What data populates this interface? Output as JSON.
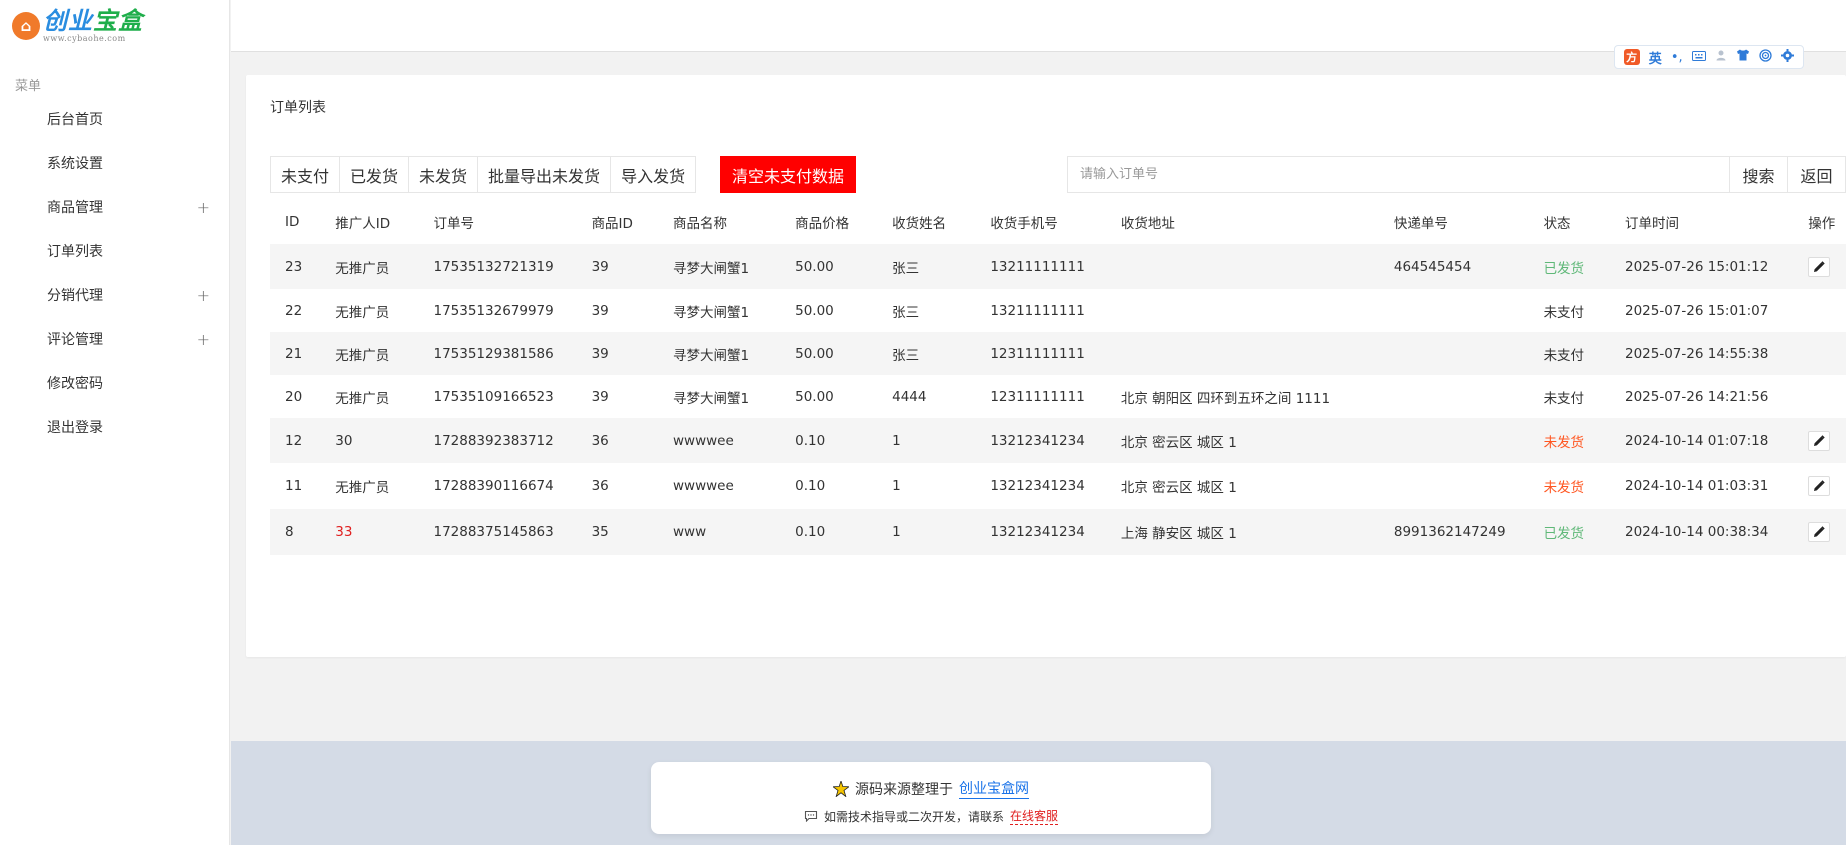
{
  "sidebar": {
    "logo_text_1": "创业",
    "logo_text_2": "宝盒",
    "logo_url": "www.cybaohe.com",
    "caption": "菜单",
    "items": [
      {
        "label": "后台首页",
        "expand": ""
      },
      {
        "label": "系统设置",
        "expand": ""
      },
      {
        "label": "商品管理",
        "expand": "+"
      },
      {
        "label": "订单列表",
        "expand": ""
      },
      {
        "label": "分销代理",
        "expand": "+"
      },
      {
        "label": "评论管理",
        "expand": "+"
      },
      {
        "label": "修改密码",
        "expand": ""
      },
      {
        "label": "退出登录",
        "expand": ""
      }
    ]
  },
  "ime": {
    "logo": "方",
    "lang": "英",
    "punct": "•,"
  },
  "card": {
    "title": "订单列表"
  },
  "filters": {
    "buttons": [
      "未支付",
      "已发货",
      "未发货",
      "批量导出未发货",
      "导入发货"
    ],
    "danger": "清空未支付数据"
  },
  "search": {
    "placeholder": "请输入订单号",
    "search_label": "搜索",
    "back_label": "返回"
  },
  "table": {
    "headers": [
      "ID",
      "推广人ID",
      "订单号",
      "商品ID",
      "商品名称",
      "商品价格",
      "收货姓名",
      "收货手机号",
      "收货地址",
      "快递单号",
      "状态",
      "订单时间",
      "操作"
    ],
    "rows": [
      {
        "id": "23",
        "promoter": "无推广员",
        "order_no": "17535132721319",
        "product_id": "39",
        "product_name": "寻梦大闸蟹1",
        "price": "50.00",
        "name": "张三",
        "phone": "13211111111",
        "address": "",
        "tracking": "464545454",
        "status": "已发货",
        "time": "2025-07-26 15:01:12",
        "editable": true
      },
      {
        "id": "22",
        "promoter": "无推广员",
        "order_no": "17535132679979",
        "product_id": "39",
        "product_name": "寻梦大闸蟹1",
        "price": "50.00",
        "name": "张三",
        "phone": "13211111111",
        "address": "",
        "tracking": "",
        "status": "未支付",
        "time": "2025-07-26 15:01:07",
        "editable": false
      },
      {
        "id": "21",
        "promoter": "无推广员",
        "order_no": "17535129381586",
        "product_id": "39",
        "product_name": "寻梦大闸蟹1",
        "price": "50.00",
        "name": "张三",
        "phone": "12311111111",
        "address": "",
        "tracking": "",
        "status": "未支付",
        "time": "2025-07-26 14:55:38",
        "editable": false
      },
      {
        "id": "20",
        "promoter": "无推广员",
        "order_no": "17535109166523",
        "product_id": "39",
        "product_name": "寻梦大闸蟹1",
        "price": "50.00",
        "name": "4444",
        "phone": "12311111111",
        "address": "北京 朝阳区 四环到五环之间 1111",
        "tracking": "",
        "status": "未支付",
        "time": "2025-07-26 14:21:56",
        "editable": false
      },
      {
        "id": "12",
        "promoter": "30",
        "order_no": "17288392383712",
        "product_id": "36",
        "product_name": "wwwwee",
        "price": "0.10",
        "name": "1",
        "phone": "13212341234",
        "address": "北京 密云区 城区 1",
        "tracking": "",
        "status": "未发货",
        "time": "2024-10-14 01:07:18",
        "editable": true
      },
      {
        "id": "11",
        "promoter": "无推广员",
        "order_no": "17288390116674",
        "product_id": "36",
        "product_name": "wwwwee",
        "price": "0.10",
        "name": "1",
        "phone": "13212341234",
        "address": "北京 密云区 城区 1",
        "tracking": "",
        "status": "未发货",
        "time": "2024-10-14 01:03:31",
        "editable": true
      },
      {
        "id": "8",
        "promoter": "33",
        "order_no": "17288375145863",
        "product_id": "35",
        "product_name": "www",
        "price": "0.10",
        "name": "1",
        "phone": "13212341234",
        "address": "上海 静安区 城区 1",
        "tracking": "8991362147249",
        "status": "已发货",
        "time": "2024-10-14 00:38:34",
        "editable": true
      }
    ]
  },
  "colors": {
    "shipped": "#5fb878",
    "unshipped": "#ff5722",
    "danger": "#ff0000",
    "promoter_highlight": "#e02020"
  },
  "notice": {
    "line1_text": "源码来源整理于",
    "line1_link": "创业宝盒网",
    "line2_text": "如需技术指导或二次开发，请联系",
    "line2_link": "在线客服"
  }
}
